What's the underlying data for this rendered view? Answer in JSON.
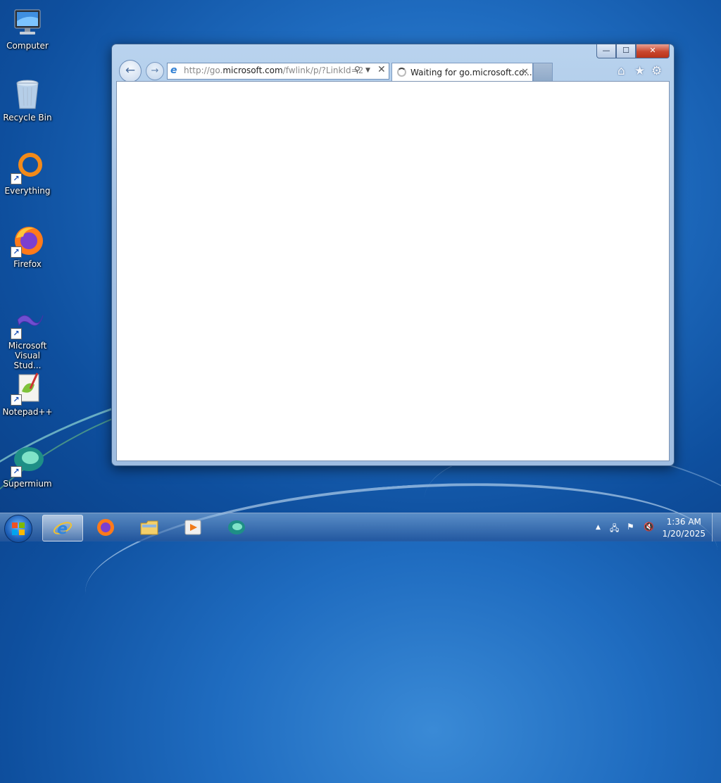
{
  "desktop": {
    "icons": [
      {
        "label": "Computer"
      },
      {
        "label": "Recycle Bin"
      },
      {
        "label": "Everything"
      },
      {
        "label": "Firefox"
      },
      {
        "label": "Microsoft Visual Stud..."
      },
      {
        "label": "Notepad++"
      },
      {
        "label": "Supermium"
      }
    ]
  },
  "browser": {
    "address": {
      "prefix": "http://go.",
      "domain": "microsoft.com",
      "path": "/fwlink/p/?LinkId=2"
    },
    "tab": {
      "title": "Waiting for go.microsoft.co..."
    },
    "caption": {
      "minimize": "—",
      "maximize": "☐",
      "close": "✕"
    }
  },
  "taskbar": {
    "pinned": [
      "Internet Explorer",
      "Firefox",
      "File Explorer",
      "Media Player",
      "Supermium"
    ],
    "clock": {
      "time": "1:36 AM",
      "date": "1/20/2025"
    }
  },
  "colors": {
    "accent": "#1f6cc0",
    "close": "#c8462d"
  }
}
